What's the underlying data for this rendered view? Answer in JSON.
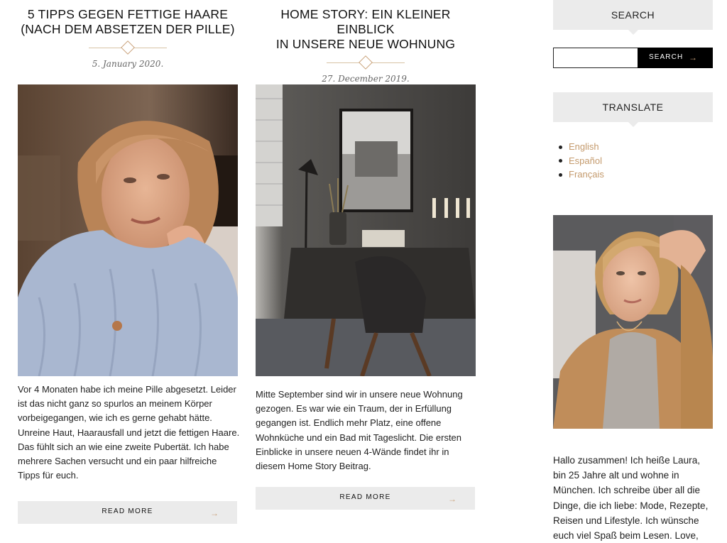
{
  "posts": [
    {
      "title_line1": "5 Tipps gegen fettige Haare",
      "title_line2": "(nach dem Absetzen der Pille)",
      "date": "5. January 2020.",
      "excerpt": "Vor 4 Monaten habe ich meine Pille abgesetzt. Leider ist das nicht ganz so spurlos an meinem Körper vorbeigegangen, wie ich es gerne gehabt hätte. Unreine Haut, Haarausfall und jetzt die fettigen Haare. Das fühlt sich an wie eine zweite Pubertät. Ich habe mehrere Sachen versucht und ein paar hilfreiche Tipps für euch.",
      "read_more": "READ MORE"
    },
    {
      "title_line1": "Home Story: Ein kleiner Einblick",
      "title_line2": "in unsere neue Wohnung",
      "date": "27. December 2019.",
      "excerpt": "Mitte September sind wir in unsere neue Wohnung gezogen. Es war wie ein Traum, der in Erfüllung gegangen ist. Endlich mehr Platz, eine offene Wohnküche und ein Bad mit Tageslicht. Die ersten Einblicke in unsere neuen 4-Wände findet ihr in diesem Home Story Beitrag.",
      "read_more": "READ MORE"
    }
  ],
  "sidebar": {
    "search_title": "SEARCH",
    "search_button": "SEARCH",
    "search_value": "",
    "translate_title": "TRANSLATE",
    "languages": [
      "English",
      "Español",
      "Français"
    ],
    "about_text": "Hallo zusammen! Ich heiße Laura, bin 25 Jahre alt und wohne in München. Ich schreibe über all die Dinge, die ich liebe: Mode, Rezepte, Reisen und Lifestyle. Ich wünsche euch viel Spaß beim Lesen. Love,"
  },
  "icons": {
    "read_more": "arrow-right-icon",
    "search": "arrow-right-icon",
    "divider": "diamond-icon"
  },
  "colors": {
    "accent": "#c49a6c",
    "widget_bg": "#ebebeb",
    "button_dark": "#000000"
  }
}
